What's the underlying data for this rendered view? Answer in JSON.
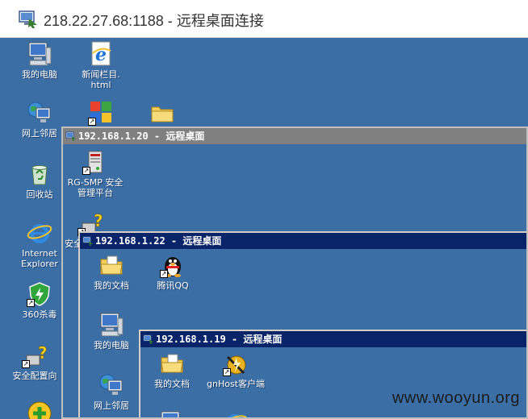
{
  "window": {
    "title": "218.22.27.68:1188 - 远程桌面连接"
  },
  "desktop_icons": [
    {
      "label": "我的电脑"
    },
    {
      "label": "新闻栏目.",
      "label2": "html"
    },
    {
      "label": "网上邻居"
    },
    {
      "label": "回收站"
    },
    {
      "label": "Internet",
      "label2": "Explorer"
    },
    {
      "label": "360杀毒"
    },
    {
      "label": "安全配置向"
    }
  ],
  "rd1": {
    "title": "192.168.1.20 - 远程桌面",
    "icons": [
      {
        "label": "RG-SMP 安全",
        "label2": "管理平台"
      },
      {
        "label": "安全"
      }
    ]
  },
  "rd2": {
    "title": "192.168.1.22 - 远程桌面",
    "icons": [
      {
        "label": "我的文档"
      },
      {
        "label": "腾讯QQ"
      },
      {
        "label": "我的电脑"
      },
      {
        "label": "网上邻居"
      }
    ]
  },
  "rd3": {
    "title": "192.168.1.19 - 远程桌面",
    "icons": [
      {
        "label": "我的文档"
      },
      {
        "label": "gnHost客户端"
      }
    ]
  },
  "watermark": "www.wooyun.org",
  "colors": {
    "desktop": "#3a6ea5",
    "inactive_titlebar": "#808080",
    "active_titlebar": "#0a246a"
  }
}
